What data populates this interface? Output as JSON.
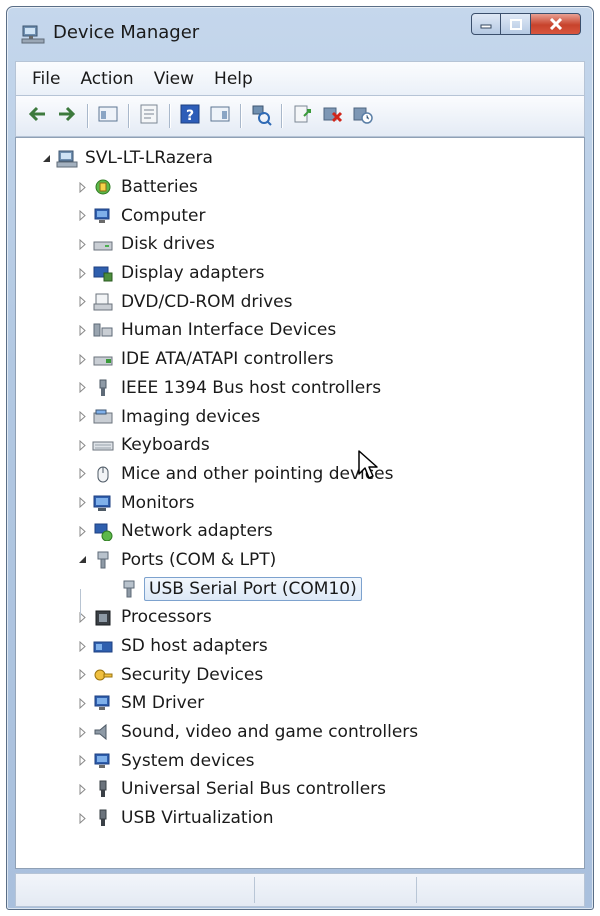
{
  "window": {
    "title": "Device Manager"
  },
  "menu": [
    "File",
    "Action",
    "View",
    "Help"
  ],
  "toolbar": [
    {
      "icon": "back-arrow-icon"
    },
    {
      "icon": "forward-arrow-icon"
    },
    {
      "sep": true
    },
    {
      "icon": "show-hide-console-tree-icon"
    },
    {
      "sep": true
    },
    {
      "icon": "properties-icon"
    },
    {
      "sep": true
    },
    {
      "icon": "help-icon"
    },
    {
      "icon": "action-pane-icon"
    },
    {
      "sep": true
    },
    {
      "icon": "scan-hardware-changes-icon"
    },
    {
      "sep": true
    },
    {
      "icon": "update-driver-icon"
    },
    {
      "icon": "uninstall-icon"
    },
    {
      "icon": "disable-device-icon"
    }
  ],
  "tree": {
    "root": "SVL-LT-LRazera",
    "categories": [
      {
        "label": "Batteries",
        "icon": "battery-icon"
      },
      {
        "label": "Computer",
        "icon": "computer-icon"
      },
      {
        "label": "Disk drives",
        "icon": "disk-drive-icon"
      },
      {
        "label": "Display adapters",
        "icon": "display-adapter-icon"
      },
      {
        "label": "DVD/CD-ROM drives",
        "icon": "dvd-drive-icon"
      },
      {
        "label": "Human Interface Devices",
        "icon": "hid-icon"
      },
      {
        "label": "IDE ATA/ATAPI controllers",
        "icon": "ide-controller-icon"
      },
      {
        "label": "IEEE 1394 Bus host controllers",
        "icon": "ieee1394-icon"
      },
      {
        "label": "Imaging devices",
        "icon": "imaging-device-icon"
      },
      {
        "label": "Keyboards",
        "icon": "keyboard-icon"
      },
      {
        "label": "Mice and other pointing devices",
        "icon": "mouse-icon"
      },
      {
        "label": "Monitors",
        "icon": "monitor-icon"
      },
      {
        "label": "Network adapters",
        "icon": "network-adapter-icon"
      },
      {
        "label": "Ports (COM & LPT)",
        "icon": "port-icon",
        "expanded": true,
        "children": [
          {
            "label": "USB Serial Port (COM10)",
            "icon": "port-icon",
            "selected": true
          }
        ]
      },
      {
        "label": "Processors",
        "icon": "processor-icon"
      },
      {
        "label": "SD host adapters",
        "icon": "sd-adapter-icon"
      },
      {
        "label": "Security Devices",
        "icon": "security-device-icon"
      },
      {
        "label": "SM Driver",
        "icon": "sm-driver-icon"
      },
      {
        "label": "Sound, video and game controllers",
        "icon": "sound-icon"
      },
      {
        "label": "System devices",
        "icon": "system-device-icon"
      },
      {
        "label": "Universal Serial Bus controllers",
        "icon": "usb-icon"
      },
      {
        "label": "USB Virtualization",
        "icon": "usb-icon"
      }
    ]
  }
}
